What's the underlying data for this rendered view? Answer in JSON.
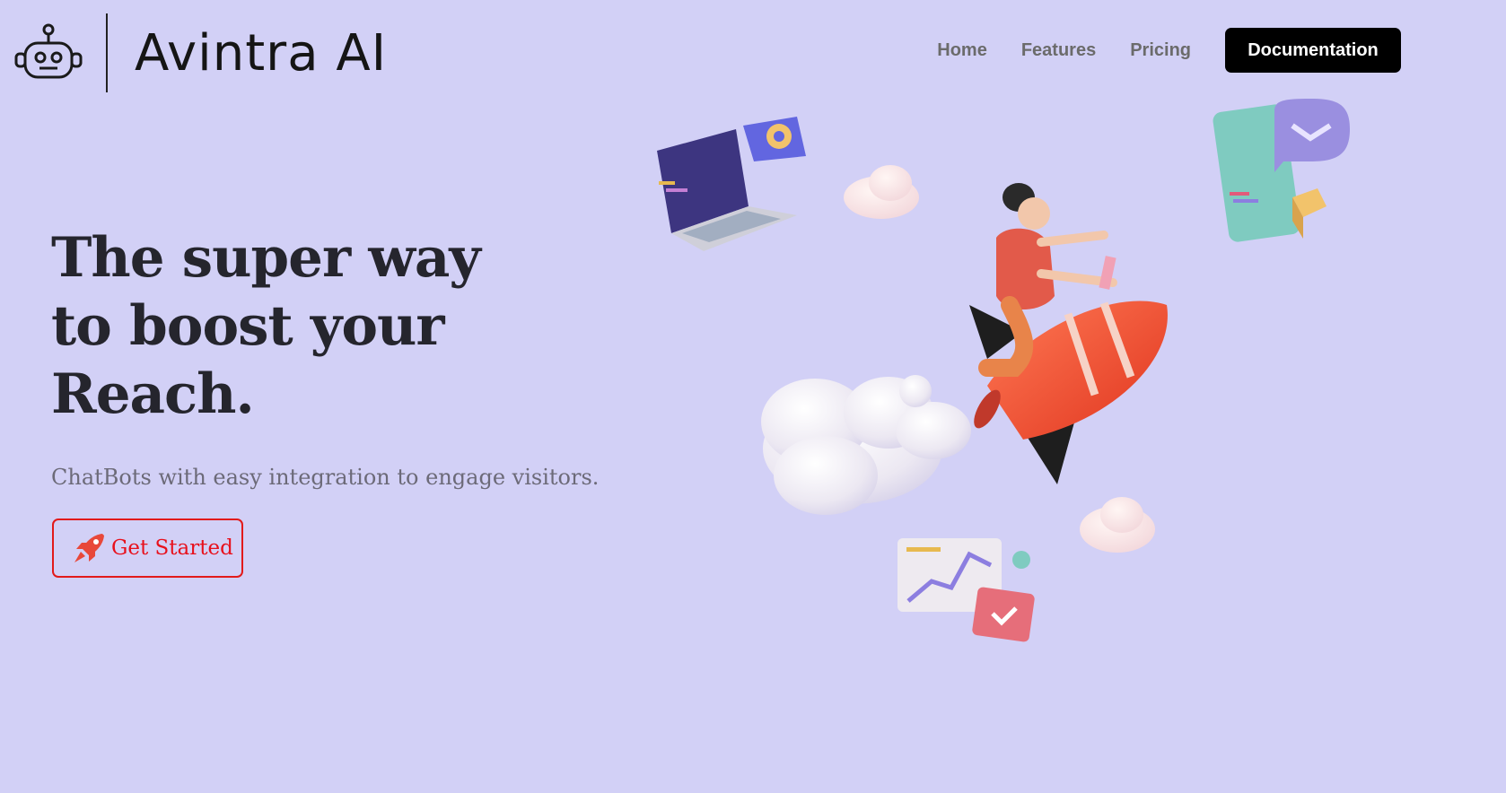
{
  "header": {
    "brand": "Avintra AI",
    "logo_icon": "robot-icon",
    "nav": [
      {
        "label": "Home"
      },
      {
        "label": "Features"
      },
      {
        "label": "Pricing"
      }
    ],
    "cta_label": "Documentation"
  },
  "hero": {
    "title_lines": [
      "The super way",
      "to boost your",
      "Reach."
    ],
    "subtitle": "ChatBots with easy integration to engage visitors.",
    "button_label": "Get Started",
    "button_icon": "rocket-icon"
  },
  "colors": {
    "background": "#d2d0f6",
    "accent_red": "#e21a1a",
    "nav_text": "#6b6b6b",
    "title_text": "#25252d"
  }
}
